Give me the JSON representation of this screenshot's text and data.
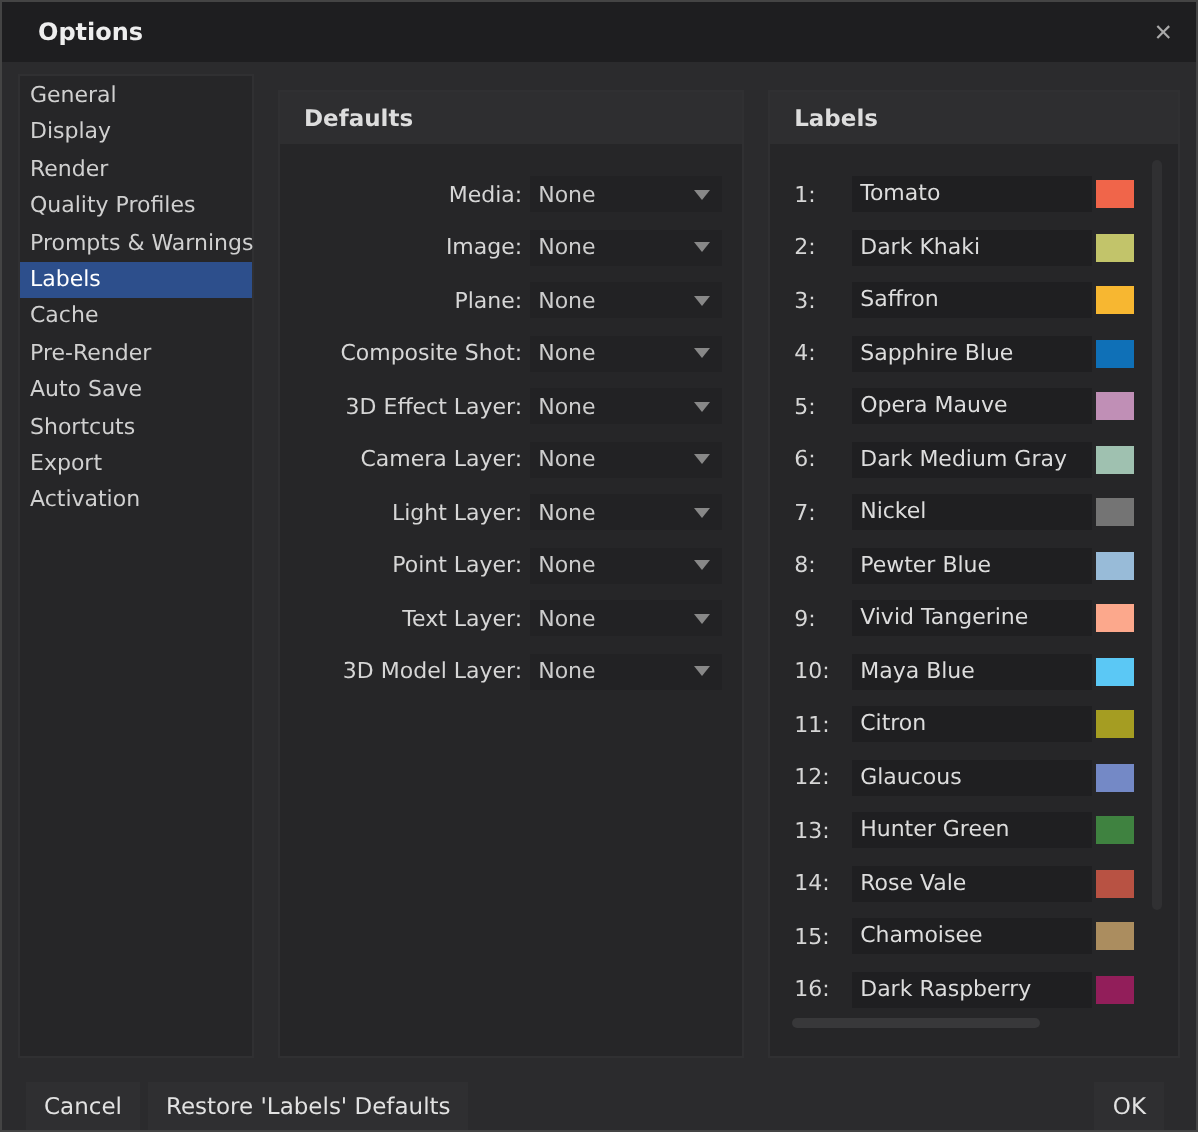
{
  "window": {
    "title": "Options",
    "close": "×"
  },
  "sidebar": {
    "items": [
      {
        "label": "General",
        "selected": false
      },
      {
        "label": "Display",
        "selected": false
      },
      {
        "label": "Render",
        "selected": false
      },
      {
        "label": "Quality Profiles",
        "selected": false
      },
      {
        "label": "Prompts & Warnings",
        "selected": false
      },
      {
        "label": "Labels",
        "selected": true
      },
      {
        "label": "Cache",
        "selected": false
      },
      {
        "label": "Pre-Render",
        "selected": false
      },
      {
        "label": "Auto Save",
        "selected": false
      },
      {
        "label": "Shortcuts",
        "selected": false
      },
      {
        "label": "Export",
        "selected": false
      },
      {
        "label": "Activation",
        "selected": false
      }
    ]
  },
  "defaults": {
    "title": "Defaults",
    "fields": [
      {
        "label": "Media:",
        "value": "None"
      },
      {
        "label": "Image:",
        "value": "None"
      },
      {
        "label": "Plane:",
        "value": "None"
      },
      {
        "label": "Composite Shot:",
        "value": "None"
      },
      {
        "label": "3D Effect Layer:",
        "value": "None"
      },
      {
        "label": "Camera Layer:",
        "value": "None"
      },
      {
        "label": "Light Layer:",
        "value": "None"
      },
      {
        "label": "Point Layer:",
        "value": "None"
      },
      {
        "label": "Text Layer:",
        "value": "None"
      },
      {
        "label": "3D Model Layer:",
        "value": "None"
      }
    ]
  },
  "labels": {
    "title": "Labels",
    "items": [
      {
        "index": "1:",
        "name": "Tomato",
        "color": "#f0654a"
      },
      {
        "index": "2:",
        "name": "Dark Khaki",
        "color": "#c2c46a"
      },
      {
        "index": "3:",
        "name": "Saffron",
        "color": "#f7b731"
      },
      {
        "index": "4:",
        "name": "Sapphire Blue",
        "color": "#0f70b7"
      },
      {
        "index": "5:",
        "name": "Opera Mauve",
        "color": "#c08fb6"
      },
      {
        "index": "6:",
        "name": "Dark Medium Gray",
        "color": "#9fc1b0"
      },
      {
        "index": "7:",
        "name": "Nickel",
        "color": "#747474"
      },
      {
        "index": "8:",
        "name": "Pewter Blue",
        "color": "#98bbd8"
      },
      {
        "index": "9:",
        "name": "Vivid Tangerine",
        "color": "#fca88c"
      },
      {
        "index": "10:",
        "name": "Maya Blue",
        "color": "#5bc8f5"
      },
      {
        "index": "11:",
        "name": "Citron",
        "color": "#a59d22"
      },
      {
        "index": "12:",
        "name": "Glaucous",
        "color": "#7489c6"
      },
      {
        "index": "13:",
        "name": "Hunter Green",
        "color": "#3f8240"
      },
      {
        "index": "14:",
        "name": "Rose Vale",
        "color": "#b85243"
      },
      {
        "index": "15:",
        "name": "Chamoisee",
        "color": "#ab8d5f"
      },
      {
        "index": "16:",
        "name": "Dark Raspberry",
        "color": "#921e5a"
      }
    ]
  },
  "buttons": [
    {
      "label": "Cancel",
      "kind": "left"
    },
    {
      "label": "Restore 'Labels' Defaults",
      "kind": "left"
    },
    {
      "label": "OK",
      "kind": "right"
    }
  ]
}
